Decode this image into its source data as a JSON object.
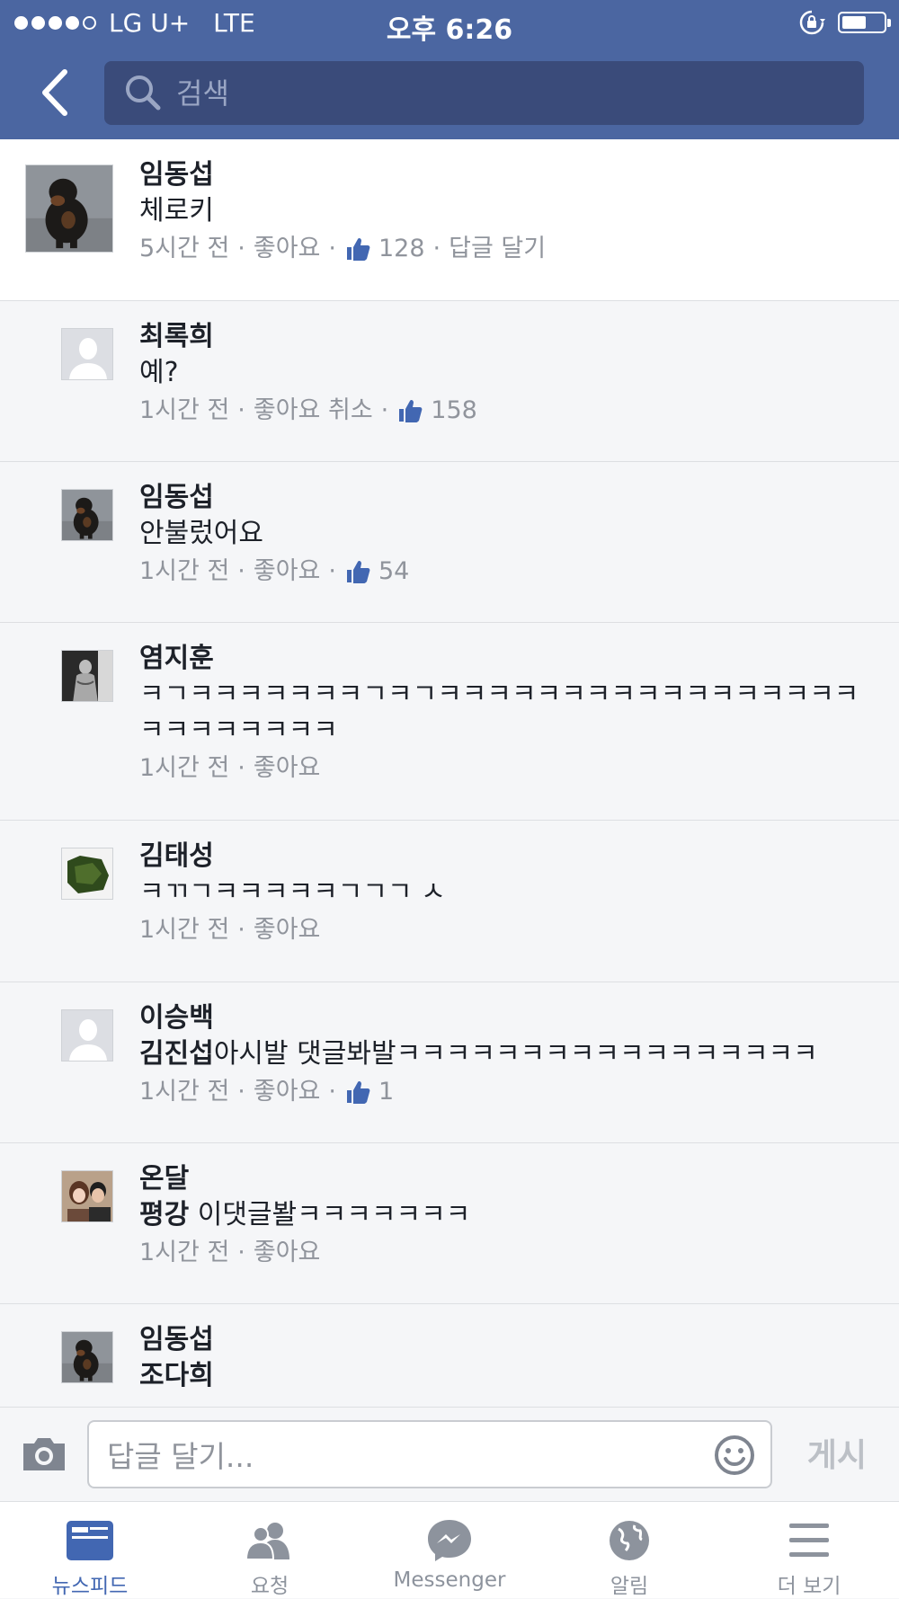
{
  "status_bar": {
    "carrier": "LG U+",
    "network": "LTE",
    "time": "오후 6:26",
    "signal_bars_filled": 4,
    "signal_bars_total": 5,
    "battery_level": 0.6
  },
  "search": {
    "placeholder": "검색"
  },
  "comments": [
    {
      "name": "임동섭",
      "text": "체로키",
      "time": "5시간 전",
      "like": "좋아요",
      "like_count": "128",
      "reply": "답글 달기",
      "avatar": "rottweiler-dog"
    },
    {
      "name": "최록희",
      "text": "예?",
      "time": "1시간 전",
      "like": "좋아요 취소",
      "like_count": "158",
      "avatar": "default-silhouette"
    },
    {
      "name": "임동섭",
      "text": "안불렀어요",
      "time": "1시간 전",
      "like": "좋아요",
      "like_count": "54",
      "avatar": "rottweiler-dog"
    },
    {
      "name": "염지훈",
      "text": "ㅋㄱㅋㅋㅋㅋㅋㅋㅋㄱㅋㄱㅋㅋㅋㅋㅋㅋㅋㅋㅋㅋㅋㅋㅋㅋㅋㅋㅋㅋㅋㅋㅋㅋㅋㅋㅋ",
      "time": "1시간 전",
      "like": "좋아요",
      "avatar": "person-photo-bw"
    },
    {
      "name": "김태성",
      "text": "ㅋㄲㄱㅋㅋㅋㅋㅋㄱㄱㄱ ㅅ",
      "time": "1시간 전",
      "like": "좋아요",
      "avatar": "seaweed-photo"
    },
    {
      "name": "이승백",
      "mention": "김진섭",
      "text": "아시발 댓글봐발ㅋㅋㅋㅋㅋㅋㅋㅋㅋㅋㅋㅋㅋㅋㅋㅋㅋ",
      "time": "1시간 전",
      "like": "좋아요",
      "like_count": "1",
      "avatar": "default-silhouette"
    },
    {
      "name": "온달",
      "mention": "평강",
      "text": " 이댓글봘ㅋㅋㅋㅋㅋㅋㅋ",
      "time": "1시간 전",
      "like": "좋아요",
      "avatar": "couple-photo"
    },
    {
      "name": "임동섭",
      "mention": "조다희",
      "text": "",
      "avatar": "rottweiler-dog"
    }
  ],
  "composer": {
    "placeholder": "답글 달기...",
    "post_label": "게시",
    "camera_icon": "camera-icon",
    "emoji_icon": "smiley-icon"
  },
  "tabs": [
    {
      "label": "뉴스피드",
      "icon": "news-feed-icon",
      "active": true
    },
    {
      "label": "요청",
      "icon": "friend-requests-icon",
      "active": false
    },
    {
      "label": "Messenger",
      "icon": "messenger-icon",
      "active": false
    },
    {
      "label": "알림",
      "icon": "globe-notifications-icon",
      "active": false
    },
    {
      "label": "더 보기",
      "icon": "hamburger-menu-icon",
      "active": false
    }
  ],
  "colors": {
    "header_blue": "#4b66a1",
    "search_bg": "#3a4b7a",
    "active_tab": "#4267b2",
    "meta_gray": "#90949c"
  }
}
